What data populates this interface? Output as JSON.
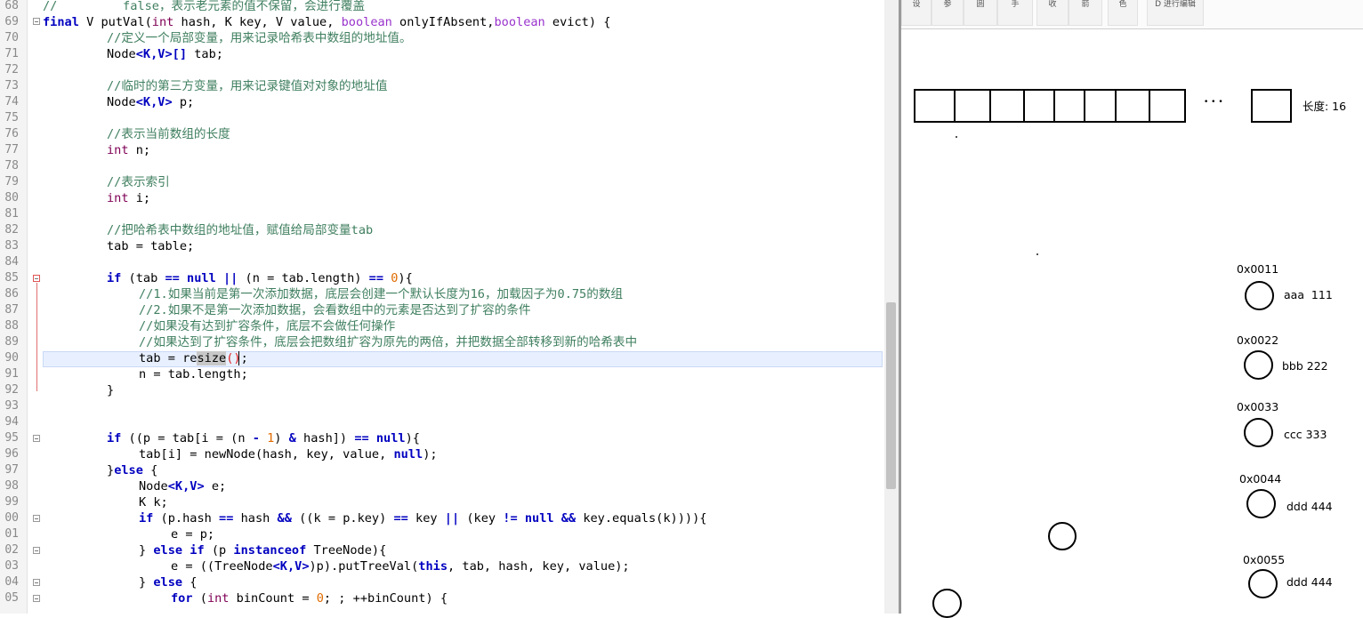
{
  "editor": {
    "line_numbers": [
      "68",
      "69",
      "70",
      "71",
      "72",
      "73",
      "74",
      "75",
      "76",
      "77",
      "78",
      "79",
      "80",
      "81",
      "82",
      "83",
      "84",
      "85",
      "86",
      "87",
      "88",
      "89",
      "90",
      "91",
      "92",
      "93",
      "94",
      "95",
      "96",
      "97",
      "98",
      "99",
      "00",
      "01",
      "02",
      "03",
      "04",
      "05"
    ],
    "code": {
      "l68": {
        "a": "//         false，表示老元素的值不保留，会进行覆盖"
      },
      "l69": {
        "a": "final",
        "b": " V putVal(",
        "c": "int",
        "d": " hash, K key, V value, ",
        "e": "boolean",
        "f": " onlyIfAbsent,",
        "g": "boolean",
        "h": " evict) {"
      },
      "l70": {
        "a": "//定义一个局部变量，用来记录哈希表中数组的地址值。"
      },
      "l71": {
        "a": "Node",
        "b": "<K,V>[]",
        "c": " tab;"
      },
      "l73": {
        "a": "//临时的第三方变量，用来记录键值对对象的地址值"
      },
      "l74": {
        "a": "Node",
        "b": "<K,V>",
        "c": " p;"
      },
      "l76": {
        "a": "//表示当前数组的长度"
      },
      "l77": {
        "a": "int",
        "b": " n;"
      },
      "l79": {
        "a": "//表示索引"
      },
      "l80": {
        "a": "int",
        "b": " i;"
      },
      "l82": {
        "a": "//把哈希表中数组的地址值，赋值给局部变量tab"
      },
      "l83": {
        "a": "tab = table;"
      },
      "l85": {
        "a": "if",
        "b": " (tab ",
        "c": "==",
        "d": " null",
        "e": " || ",
        "f": "(n = tab.length) ",
        "g": "==",
        "h": " ",
        "i": "0",
        "j": "){"
      },
      "l86": {
        "a": "//1.如果当前是第一次添加数据，底层会创建一个默认长度为16，加载因子为0.75的数组"
      },
      "l87": {
        "a": "//2.如果不是第一次添加数据，会看数组中的元素是否达到了扩容的条件"
      },
      "l88": {
        "a": "//如果没有达到扩容条件，底层不会做任何操作"
      },
      "l89": {
        "a": "//如果达到了扩容条件，底层会把数组扩容为原先的两倍，并把数据全部转移到新的哈希表中"
      },
      "l90": {
        "a": "tab = re",
        "b": "size",
        "c": "()",
        "d": ";"
      },
      "l91": {
        "a": "n = tab.length;"
      },
      "l92": {
        "a": "}"
      },
      "l95": {
        "a": "if",
        "b": " ((p = tab[i = (n ",
        "c": "-",
        "d": " ",
        "e": "1",
        "f": ") ",
        "g": "&",
        "h": " hash]) ",
        "i": "==",
        "j": " null",
        "k": "){"
      },
      "l96": {
        "a": "tab[i] = newNode(hash, key, value, ",
        "b": "null",
        "c": ");"
      },
      "l97": {
        "a": "}",
        "b": "else",
        "c": " {"
      },
      "l98": {
        "a": "Node",
        "b": "<K,V>",
        "c": " e;"
      },
      "l99": {
        "a": "K k;"
      },
      "l00": {
        "a": "if",
        "b": " (p.hash ",
        "c": "==",
        "d": " hash ",
        "e": "&&",
        "f": " ((k = p.key) ",
        "g": "==",
        "h": " key ",
        "i": "||",
        "j": " (key ",
        "k": "!=",
        "l": " null",
        "m": " && ",
        "n": "key.equals(k)))){"
      },
      "l01": {
        "a": "e = p;"
      },
      "l02": {
        "a": "} ",
        "b": "else if",
        "c": " (p ",
        "d": "instanceof",
        "e": " TreeNode){"
      },
      "l03": {
        "a": "e = ((TreeNode",
        "b": "<K,V>",
        "c": ")p).putTreeVal(",
        "d": "this",
        "e": ", tab, hash, key, value);"
      },
      "l04": {
        "a": "} ",
        "b": "else",
        "c": " {"
      },
      "l05": {
        "a": "for",
        "b": " (",
        "c": "int",
        "d": " binCount = ",
        "e": "0",
        "f": "; ; ++binCount) {"
      }
    }
  },
  "canvas": {
    "ribbon": [
      "设",
      "参",
      "圆",
      "手",
      "收",
      "箭",
      "色",
      "D 进行编辑"
    ],
    "ellipsis": "• • •",
    "length_label": "长度: 16",
    "nodes": [
      {
        "address": "0x0011",
        "content": "aaa  111"
      },
      {
        "address": "0x0022",
        "content": "bbb 222"
      },
      {
        "address": "0x0033",
        "content": "ccc 333"
      },
      {
        "address": "0x0044",
        "content": "ddd 444"
      },
      {
        "address": "0x0055",
        "content": "ddd 444"
      }
    ]
  }
}
